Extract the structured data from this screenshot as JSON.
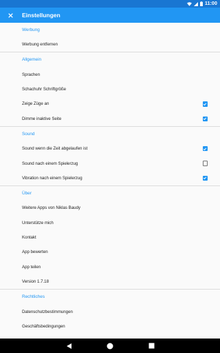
{
  "status_bar": {
    "time": "11:00"
  },
  "app_bar": {
    "title": "Einstellungen"
  },
  "sections": {
    "werbung": {
      "header": "Werbung",
      "items": [
        "Werbung entfernen"
      ]
    },
    "allgemein": {
      "header": "Allgemein",
      "items": [
        {
          "label": "Sprachen"
        },
        {
          "label": "Schachuhr Schriftgröße"
        },
        {
          "label": "Zeige Züge an",
          "checked": true
        },
        {
          "label": "Dimme inaktive Seite",
          "checked": true
        }
      ]
    },
    "sound": {
      "header": "Sound",
      "items": [
        {
          "label": "Sound wenn die Zeit abgelaufen ist",
          "checked": true
        },
        {
          "label": "Sound nach einem Spielerzug",
          "checked": false
        },
        {
          "label": "Vibration nach einem Spielerzug",
          "checked": true
        }
      ]
    },
    "ueber": {
      "header": "Über",
      "items": [
        "Weitere Apps von Niklas Baudy",
        "Unterstütze mich",
        "Kontakt",
        "App bewerten",
        "App teilen",
        "Version 1.7.18"
      ]
    },
    "rechtliches": {
      "header": "Rechtliches",
      "items": [
        "Datenschutzbestimmungen",
        "Geschäftsbedingungen"
      ]
    }
  },
  "colors": {
    "status_bar": "#1976d2",
    "app_bar": "#2196f3",
    "accent": "#2196f3",
    "background": "#fafafa",
    "nav_bar": "#000000"
  },
  "icons": {
    "close": "close-icon",
    "wifi": "wifi-icon",
    "signal": "signal-icon",
    "battery": "battery-icon",
    "checkbox_checked": "checkbox-checked-icon",
    "checkbox_unchecked": "checkbox-unchecked-icon",
    "nav_back": "back-triangle-icon",
    "nav_home": "home-circle-icon",
    "nav_recents": "recents-square-icon"
  }
}
